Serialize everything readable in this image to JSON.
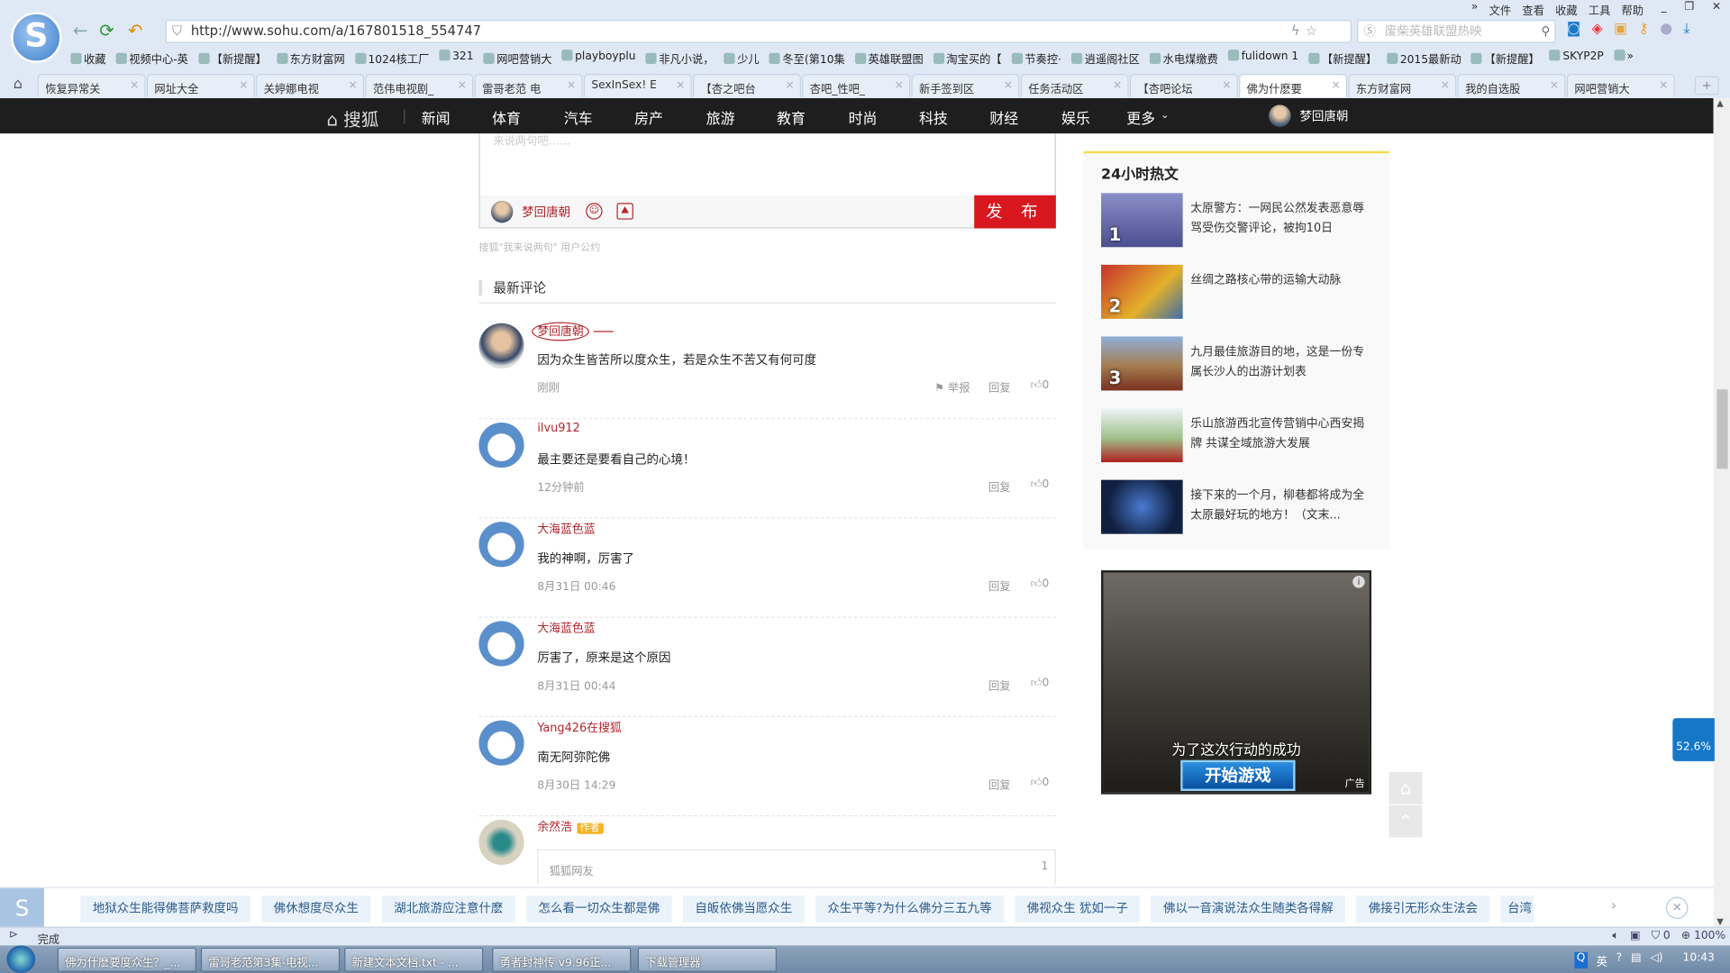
{
  "browser": {
    "url": "http://www.sohu.com/a/167801518_554747",
    "search_placeholder": "废柴英雄联盟热映",
    "menu": [
      "»",
      "文件",
      "查看",
      "收藏",
      "工具",
      "帮助"
    ],
    "bookmarks": [
      "收藏",
      "视频中心-英",
      "【新提醒】",
      "东方财富网",
      "1024核工厂",
      "321",
      "网吧营销大",
      "playboyplu",
      "非凡小说，",
      "少儿",
      "冬至(第10集",
      "英雄联盟图",
      "淘宝买的【",
      "节奏控·",
      "逍遥阁社区",
      "水电煤缴费",
      "fulidown 1",
      "【新提醒】",
      "2015最新动",
      "【新提醒】",
      "SKYP2P",
      "»"
    ],
    "tabs": [
      "恢复异常关",
      "网址大全",
      "关婷娜电视",
      "范伟电视剧_",
      "雷哥老范 电",
      "SexInSex! E",
      "【杏之吧台",
      "杏吧_性吧_",
      "新手签到区",
      "任务活动区",
      "【杏吧论坛",
      "佛为什麽要",
      "东方财富网",
      "我的自选股",
      "网吧营销大"
    ],
    "active_tab": 11,
    "new_tab": "+"
  },
  "sohu_nav": {
    "brand": "搜狐",
    "items": [
      "新闻",
      "体育",
      "汽车",
      "房产",
      "旅游",
      "教育",
      "时尚",
      "科技",
      "财经",
      "娱乐",
      "更多"
    ],
    "user": "梦回唐朝"
  },
  "composer": {
    "placeholder": "来说两句吧……",
    "user": "梦回唐朝",
    "publish": "发 布",
    "terms": "搜狐\"我来说两句\" 用户公约"
  },
  "latest_title": "最新评论",
  "comments": [
    {
      "name": "梦回唐朝",
      "text": "因为众生皆苦所以度众生，若是众生不苦又有何可度",
      "time": "刚刚",
      "report": "举报",
      "reply": "回复",
      "likes": "0"
    },
    {
      "name": "ilvu912",
      "text": "最主要还是要看自己的心境！",
      "time": "12分钟前",
      "reply": "回复",
      "likes": "0"
    },
    {
      "name": "大海蓝色蓝",
      "text": "我的神啊，厉害了",
      "time": "8月31日 00:46",
      "reply": "回复",
      "likes": "0"
    },
    {
      "name": "大海蓝色蓝",
      "text": "厉害了，原来是这个原因",
      "time": "8月31日 00:44",
      "reply": "回复",
      "likes": "0"
    },
    {
      "name": "Yang426在搜狐",
      "text": "南无阿弥陀佛",
      "time": "8月30日 14:29",
      "reply": "回复",
      "likes": "0"
    }
  ],
  "author_comment": {
    "name": "余然浩",
    "badge": "作者",
    "reply_user": "狐狐网友",
    "reply_count": "1"
  },
  "hot": {
    "title": "24小时热文",
    "items": [
      {
        "num": "1",
        "text": "太原警方：一网民公然发表恶意辱骂受伤交警评论，被拘10日"
      },
      {
        "num": "2",
        "text": "丝绸之路核心带的运输大动脉"
      },
      {
        "num": "3",
        "text": "九月最佳旅游目的地，这是一份专属长沙人的出游计划表"
      },
      {
        "num": "",
        "text": "乐山旅游西北宣传营销中心西安揭牌 共谋全域旅游大发展"
      },
      {
        "num": "",
        "text": "接下来的一个月，柳巷都将成为全太原最好玩的地方！（文末..."
      }
    ]
  },
  "ad": {
    "caption": "为了这次行动的成功",
    "button": "开始游戏",
    "label": "广告"
  },
  "widget_percent": "52.6%",
  "suggestions": [
    "地狱众生能得佛菩萨救度吗",
    "佛休想度尽众生",
    "湖北旅游应注意什麽",
    "怎么看一切众生都是佛",
    "自皈依佛当愿众生",
    "众生平等?为什么佛分三五九等",
    "佛视众生 犹如一子",
    "佛以一音演说法众生随类各得解",
    "佛接引无形众生法会",
    "台湾"
  ],
  "status": {
    "text": "完成",
    "ad_count": "0",
    "zoom": "100%"
  },
  "taskbar": {
    "tasks": [
      "佛为什麽要度众生？_...",
      "雷哥老范第3集-电视...",
      "新建文本文档.txt - ...",
      "勇者封神传 v9.96正...",
      "下载管理器"
    ],
    "ime": "英",
    "clock": "10:43"
  }
}
